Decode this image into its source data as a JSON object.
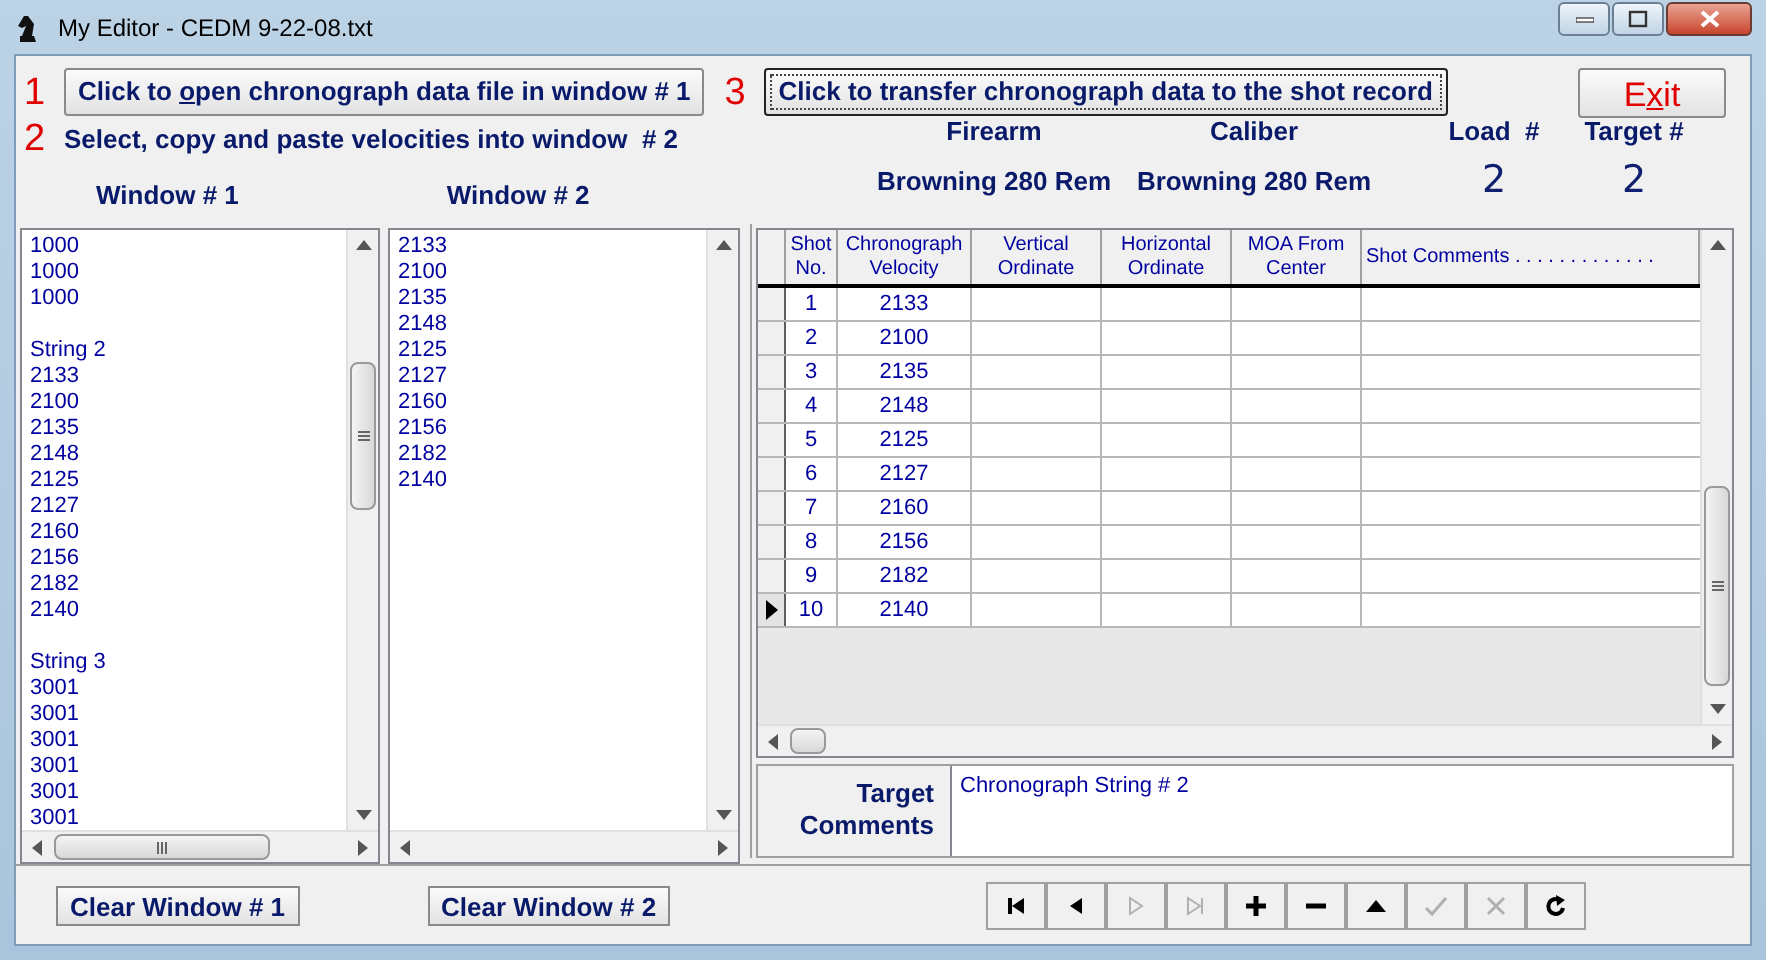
{
  "window": {
    "title": "My Editor - CEDM 9-22-08.txt"
  },
  "steps": [
    {
      "number": "1",
      "label": "Click to ",
      "underline": "o",
      "label_rest": "pen chronograph data file in window # 1",
      "kind": "button"
    },
    {
      "number": "3",
      "label": "Click to transfer chronograph data to the shot record",
      "kind": "button",
      "focused": true
    },
    {
      "number": "2",
      "label": "Select, copy and paste velocities into window  # 2",
      "kind": "text"
    }
  ],
  "exit_button": {
    "label": "E",
    "underline": "x",
    "label_rest": "it"
  },
  "info": [
    {
      "label": "Firearm",
      "value": "Browning 280 Rem"
    },
    {
      "label": "Caliber",
      "value": "Browning 280 Rem"
    },
    {
      "label": "Load  #",
      "value": "2"
    },
    {
      "label": "Target #",
      "value": "2"
    }
  ],
  "window1": {
    "title": "Window # 1",
    "groups": [
      [
        "1000",
        "1000",
        "1000"
      ],
      [
        "String 2",
        "2133",
        "2100",
        "2135",
        "2148",
        "2125",
        "2127",
        "2160",
        "2156",
        "2182",
        "2140"
      ],
      [
        "String 3",
        "3001",
        "3001",
        "3001",
        "3001",
        "3001",
        "3001"
      ]
    ]
  },
  "window2": {
    "title": "Window # 2",
    "lines": [
      "2133",
      "2100",
      "2135",
      "2148",
      "2125",
      "2127",
      "2160",
      "2156",
      "2182",
      "2140"
    ]
  },
  "table": {
    "columns": [
      "Shot No.",
      "Chronograph Velocity",
      "Vertical Ordinate",
      "Horizontal Ordinate",
      "MOA From Center",
      "Shot Comments . . . . . . . . . . . . ."
    ],
    "rows": [
      {
        "shot": "1",
        "velocity": "2133",
        "selected": false
      },
      {
        "shot": "2",
        "velocity": "2100",
        "selected": false
      },
      {
        "shot": "3",
        "velocity": "2135",
        "selected": false
      },
      {
        "shot": "4",
        "velocity": "2148",
        "selected": false
      },
      {
        "shot": "5",
        "velocity": "2125",
        "selected": false
      },
      {
        "shot": "6",
        "velocity": "2127",
        "selected": false
      },
      {
        "shot": "7",
        "velocity": "2160",
        "selected": false
      },
      {
        "shot": "8",
        "velocity": "2156",
        "selected": false
      },
      {
        "shot": "9",
        "velocity": "2182",
        "selected": false
      },
      {
        "shot": "10",
        "velocity": "2140",
        "selected": true
      }
    ]
  },
  "target_comments": {
    "label": "Target Comments",
    "value": "Chronograph String # 2"
  },
  "clear_buttons": [
    "Clear Window # 1",
    "Clear Window # 2"
  ],
  "navigator": [
    {
      "kind": "first",
      "disabled": false
    },
    {
      "kind": "prev",
      "disabled": false
    },
    {
      "kind": "next",
      "disabled": true
    },
    {
      "kind": "last",
      "disabled": true
    },
    {
      "kind": "add",
      "disabled": false
    },
    {
      "kind": "delete",
      "disabled": false
    },
    {
      "kind": "edit",
      "disabled": false
    },
    {
      "kind": "post",
      "disabled": true
    },
    {
      "kind": "cancel",
      "disabled": true
    },
    {
      "kind": "refresh",
      "disabled": false
    }
  ]
}
